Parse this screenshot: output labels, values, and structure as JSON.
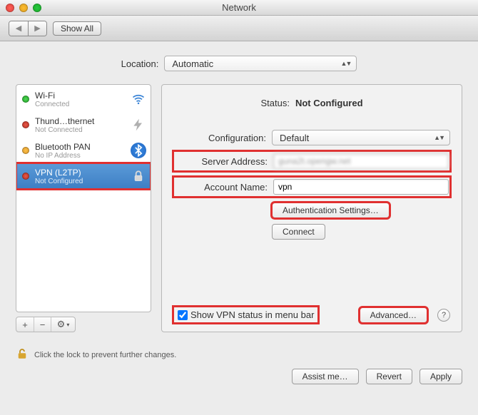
{
  "window": {
    "title": "Network"
  },
  "toolbar": {
    "show_all": "Show All"
  },
  "location": {
    "label": "Location:",
    "value": "Automatic"
  },
  "sidebar": {
    "items": [
      {
        "name": "Wi-Fi",
        "status": "Connected",
        "dot": "green",
        "icon": "wifi"
      },
      {
        "name": "Thund…thernet",
        "status": "Not Connected",
        "dot": "red",
        "icon": "thunderbolt"
      },
      {
        "name": "Bluetooth PAN",
        "status": "No IP Address",
        "dot": "amber",
        "icon": "bluetooth"
      },
      {
        "name": "VPN (L2TP)",
        "status": "Not Configured",
        "dot": "red",
        "icon": "lock",
        "selected": true
      }
    ],
    "ctrl_add": "+",
    "ctrl_remove": "−",
    "ctrl_gear": "⚙︎",
    "ctrl_menu": "▾"
  },
  "panel": {
    "status_label": "Status:",
    "status_value": "Not Configured",
    "config_label": "Configuration:",
    "config_value": "Default",
    "server_label": "Server Address:",
    "server_value": "guna2t.opengw.net",
    "account_label": "Account Name:",
    "account_value": "vpn",
    "auth_button": "Authentication Settings…",
    "connect_button": "Connect",
    "show_status_label": "Show VPN status in menu bar",
    "show_status_checked": true,
    "advanced_button": "Advanced…"
  },
  "lock": {
    "text": "Click the lock to prevent further changes."
  },
  "footer": {
    "assist": "Assist me…",
    "revert": "Revert",
    "apply": "Apply"
  }
}
